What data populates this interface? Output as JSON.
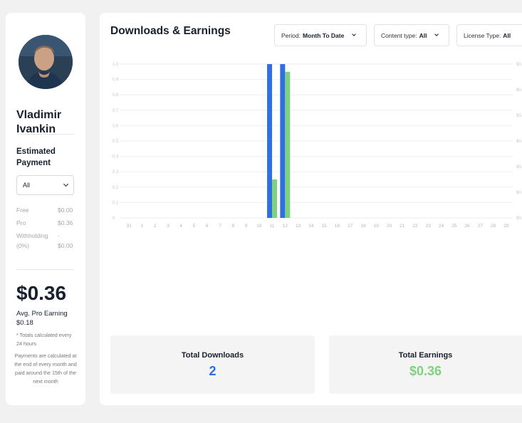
{
  "profile": {
    "name": "Vladimir Ivankin",
    "estimated_payment_title": "Estimated Payment",
    "filter_value": "All",
    "rows": [
      {
        "label": "Free",
        "value": "$0.00"
      },
      {
        "label": "Pro",
        "value": "$0.36"
      },
      {
        "label": "Withholding (0%)",
        "value": "- $0.00"
      }
    ],
    "total": "$0.36",
    "avg_label": "Avg. Pro Earning",
    "avg_value": "$0.18",
    "note_totals": "* Totals calculated every 24 hours",
    "note_payments": "Payments are calculated at the end of every month and paid around the 15th of the next month"
  },
  "main": {
    "title": "Downloads & Earnings",
    "filters": {
      "period_label": "Period:",
      "period_value": "Month To Date",
      "content_label": "Content type:",
      "content_value": "All",
      "license_label": "License Type:",
      "license_value": "All"
    },
    "stats": {
      "downloads_label": "Total Downloads",
      "downloads_value": "2",
      "earnings_label": "Total Earnings",
      "earnings_value": "$0.36"
    }
  },
  "colors": {
    "downloads": "#2f6fe0",
    "earnings": "#7fd17f"
  },
  "chart_data": {
    "type": "bar",
    "categories": [
      "31",
      "1",
      "2",
      "3",
      "4",
      "5",
      "6",
      "7",
      "8",
      "9",
      "10",
      "11",
      "12",
      "13",
      "14",
      "15",
      "16",
      "17",
      "18",
      "19",
      "20",
      "21",
      "22",
      "23",
      "24",
      "25",
      "26",
      "27",
      "28",
      "29"
    ],
    "y_ticks_left": [
      "0",
      "0.1",
      "0.2",
      "0.3",
      "0.4",
      "0.5",
      "0.6",
      "0.7",
      "0.8",
      "0.9",
      "1.0"
    ],
    "y_ticks_right": [
      "$0.",
      "$0.",
      "$0.",
      "$0.",
      "$0.",
      "$0.",
      "$0."
    ],
    "ylim": [
      0,
      1.0
    ],
    "series": [
      {
        "values": [
          0,
          0,
          0,
          0,
          0,
          0,
          0,
          0,
          0,
          0,
          0,
          1,
          1,
          0,
          0,
          0,
          0,
          0,
          0,
          0,
          0,
          0,
          0,
          0,
          0,
          0,
          0,
          0,
          0,
          0
        ]
      },
      {
        "values": [
          0,
          0,
          0,
          0,
          0,
          0,
          0,
          0,
          0,
          0,
          0,
          0.25,
          0.95,
          0,
          0,
          0,
          0,
          0,
          0,
          0,
          0,
          0,
          0,
          0,
          0,
          0,
          0,
          0,
          0,
          0
        ]
      }
    ]
  }
}
